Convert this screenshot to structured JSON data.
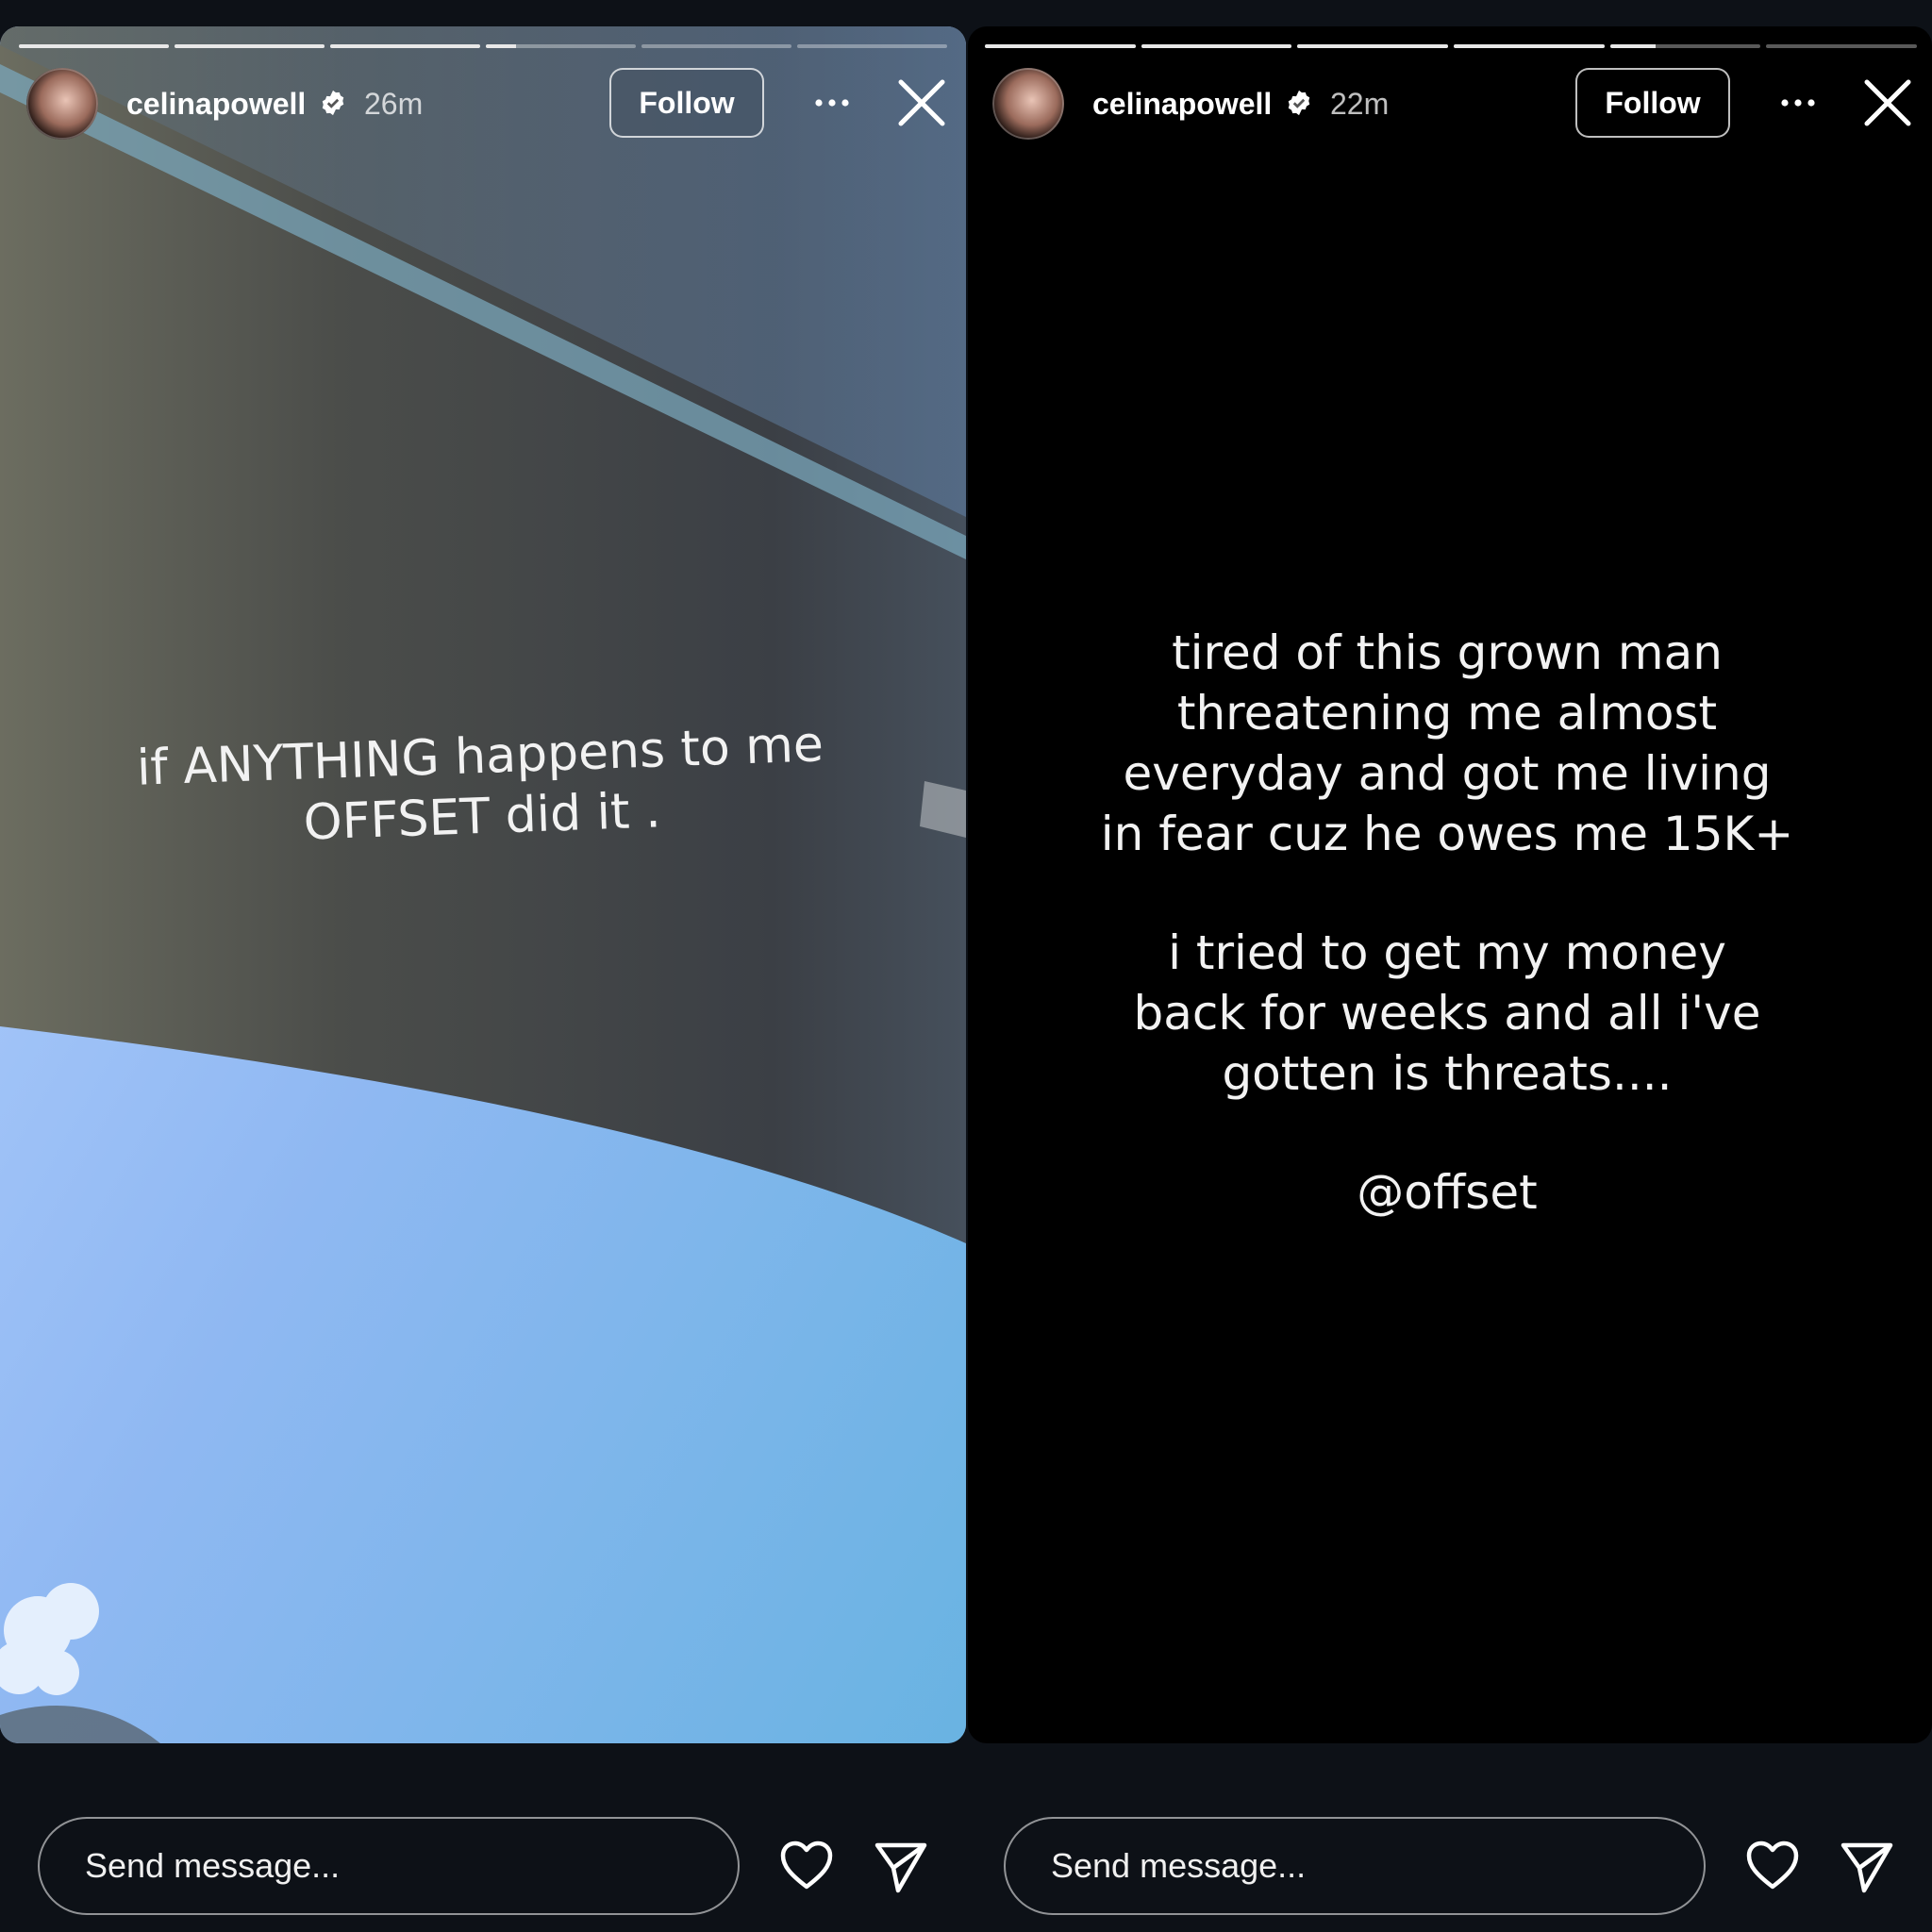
{
  "stories": [
    {
      "username": "celinapowell",
      "time": "26m",
      "follow_label": "Follow",
      "progress_fill": [
        1,
        1,
        1,
        0.2,
        0,
        0
      ],
      "text": "if ANYTHING happens to me\nOFFSET did it .",
      "reply_placeholder": "Send message...",
      "background": "photo-sky-car-window"
    },
    {
      "username": "celinapowell",
      "time": "22m",
      "follow_label": "Follow",
      "progress_fill": [
        1,
        1,
        1,
        1,
        0.3,
        0
      ],
      "paragraphs": [
        "tired of this grown man\nthreatening me almost\neveryday and got me living\nin fear cuz he owes me 15K+",
        "i tried to get my money\nback for weeks and all i've\ngotten is threats....",
        "@offset"
      ],
      "reply_placeholder": "Send message...",
      "background": "black"
    }
  ],
  "icons": {
    "verified": "verified-badge-icon",
    "more": "more-options-icon",
    "close": "close-icon",
    "heart": "heart-icon",
    "send": "send-icon"
  },
  "colors": {
    "app_background": "#0d1117",
    "text": "#ffffff",
    "sky_blue": "#8fb8f2"
  }
}
